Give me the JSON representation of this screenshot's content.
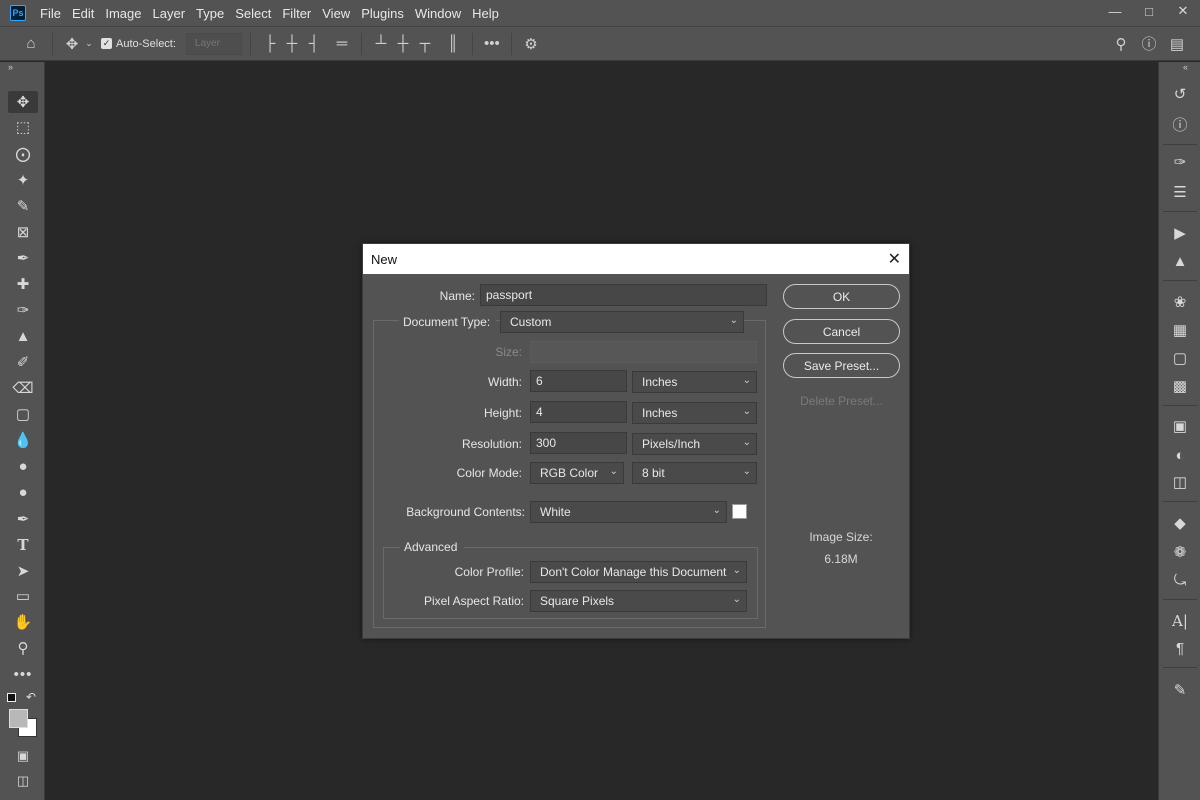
{
  "menubar": {
    "logo": "Ps",
    "items": [
      "File",
      "Edit",
      "Image",
      "Layer",
      "Type",
      "Select",
      "Filter",
      "View",
      "Plugins",
      "Window",
      "Help"
    ],
    "window_controls": [
      "minimize-icon",
      "maximize-icon",
      "close-icon"
    ]
  },
  "options": {
    "auto_select_label": "Auto-Select:",
    "auto_select_checked": true,
    "layer_select_value": "Layer"
  },
  "toolbar": {
    "tools": [
      "move-icon",
      "marquee-icon",
      "lasso-icon",
      "magic-wand-icon",
      "eyedropper-brush-icon",
      "frame-icon",
      "eyedropper-icon",
      "healing-icon",
      "brush-icon",
      "stamp-icon",
      "history-brush-icon",
      "eraser-icon",
      "gradient-icon",
      "blur-icon",
      "dodge-icon",
      "smudge-icon",
      "pen-icon",
      "type-icon",
      "path-select-icon",
      "rectangle-icon",
      "hand-icon",
      "zoom-icon",
      "more-icon"
    ],
    "foreground_color": "#b8b8b8",
    "background_color": "#ffffff"
  },
  "right_panel": {
    "icons": [
      "history-icon",
      "info-icon",
      "brush-settings-icon",
      "adjust-icon",
      "actions-play-icon",
      "clone-source-icon",
      "color-palette-icon",
      "swatches-grid-icon",
      "gradients-icon",
      "patterns-icon",
      "libraries-icon",
      "adjustments-icon",
      "properties-icon",
      "layers-icon",
      "channels-icon",
      "paths-icon",
      "character-icon",
      "paragraph-icon",
      "notes-icon"
    ]
  },
  "dialog": {
    "title": "New",
    "name_label": "Name:",
    "name_value": "passport",
    "doc_type_label": "Document Type:",
    "doc_type_value": "Custom",
    "size_label": "Size:",
    "size_value": "",
    "width_label": "Width:",
    "width_value": "6",
    "width_unit": "Inches",
    "height_label": "Height:",
    "height_value": "4",
    "height_unit": "Inches",
    "resolution_label": "Resolution:",
    "resolution_value": "300",
    "resolution_unit": "Pixels/Inch",
    "color_mode_label": "Color Mode:",
    "color_mode_value": "RGB Color",
    "bit_depth_value": "8 bit",
    "bg_contents_label": "Background Contents:",
    "bg_contents_value": "White",
    "bg_swatch_color": "#ffffff",
    "advanced_label": "Advanced",
    "color_profile_label": "Color Profile:",
    "color_profile_value": "Don't Color Manage this Document",
    "pixel_aspect_label": "Pixel Aspect Ratio:",
    "pixel_aspect_value": "Square Pixels",
    "ok_label": "OK",
    "cancel_label": "Cancel",
    "save_preset_label": "Save Preset...",
    "delete_preset_label": "Delete Preset...",
    "image_size_label": "Image Size:",
    "image_size_value": "6.18M"
  }
}
